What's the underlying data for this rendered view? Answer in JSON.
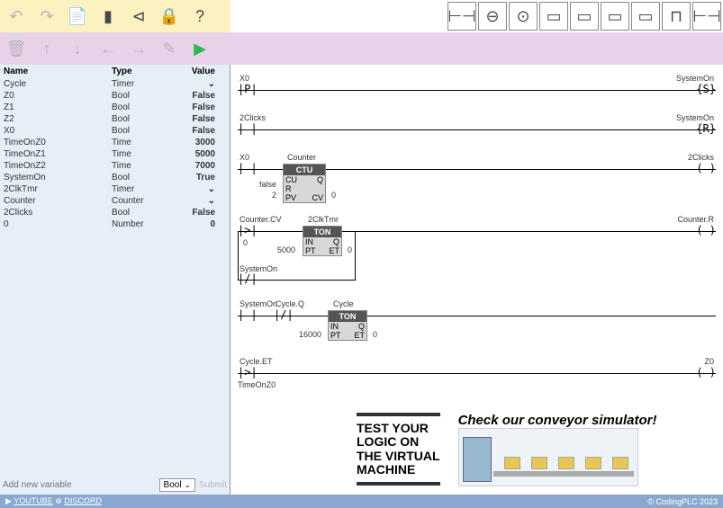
{
  "toolbar": {
    "yellow_icons": [
      "undo",
      "redo",
      "file",
      "page",
      "share",
      "lock",
      "help"
    ],
    "palette_icons": [
      "contact-no",
      "contact-nc",
      "timer",
      "block1",
      "block2",
      "block3",
      "block4",
      "coil",
      "branch"
    ],
    "purple_icons": [
      "delete",
      "up",
      "down",
      "left",
      "right",
      "edit",
      "run"
    ]
  },
  "variables": {
    "headers": {
      "name": "Name",
      "type": "Type",
      "value": "Value"
    },
    "rows": [
      {
        "name": "Cycle",
        "type": "Timer",
        "value": "⌄"
      },
      {
        "name": "Z0",
        "type": "Bool",
        "value": "False"
      },
      {
        "name": "Z1",
        "type": "Bool",
        "value": "False"
      },
      {
        "name": "Z2",
        "type": "Bool",
        "value": "False"
      },
      {
        "name": "X0",
        "type": "Bool",
        "value": "False"
      },
      {
        "name": "TimeOnZ0",
        "type": "Time",
        "value": "3000"
      },
      {
        "name": "TimeOnZ1",
        "type": "Time",
        "value": "5000"
      },
      {
        "name": "TimeOnZ2",
        "type": "Time",
        "value": "7000"
      },
      {
        "name": "SystemOn",
        "type": "Bool",
        "value": "True"
      },
      {
        "name": "2ClkTmr",
        "type": "Timer",
        "value": "⌄"
      },
      {
        "name": "Counter",
        "type": "Counter",
        "value": "⌄"
      },
      {
        "name": "2Clicks",
        "type": "Bool",
        "value": "False"
      },
      {
        "name": "0",
        "type": "Number",
        "value": "0"
      }
    ]
  },
  "add_variable": {
    "placeholder": "Add new variable",
    "type": "Bool",
    "submit": "Submit"
  },
  "ladder": {
    "r1": {
      "left_lbl": "X0",
      "left_sym": "|P|",
      "right_lbl": "SystemOn",
      "right_sym": "{S}"
    },
    "r2": {
      "left_lbl": "2Clicks",
      "left_sym": "| |",
      "right_lbl": "SystemOn",
      "right_sym": "{R}"
    },
    "r3": {
      "left_lbl": "X0",
      "left_sym": "| |",
      "blk_lbl": "Counter",
      "blk_hdr": "CTU",
      "p1": "CU",
      "p2": "Q",
      "p3": "R",
      "p4": "PV",
      "p5": "CV",
      "v1": "false",
      "v2": "2",
      "v3": "0",
      "right_lbl": "2Clicks",
      "right_sym": "( )"
    },
    "r4": {
      "left_lbl": "Counter.CV",
      "left_sym": "|>|",
      "left_sub": "0",
      "blk_lbl": "2ClkTmr",
      "blk_hdr": "TON",
      "p1": "IN",
      "p2": "Q",
      "p3": "PT",
      "p4": "ET",
      "v1": "5000",
      "v2": "0",
      "right_lbl": "Counter.R",
      "right_sym": "( )",
      "branch_lbl": "SystemOn",
      "branch_sym": "|/|"
    },
    "r5": {
      "l1_lbl": "SystemOn",
      "l1_sym": "| |",
      "l2_lbl": "Cycle.Q",
      "l2_sym": "|/|",
      "blk_lbl": "Cycle",
      "blk_hdr": "TON",
      "p1": "IN",
      "p2": "Q",
      "p3": "PT",
      "p4": "ET",
      "v1": "16000",
      "v2": "0"
    },
    "r6": {
      "left_lbl": "Cycle.ET",
      "left_sym": "|>|",
      "left_sub": "TimeOnZ0",
      "right_lbl": "Z0",
      "right_sym": "( )"
    }
  },
  "promo": {
    "text1": "TEST YOUR",
    "text2": "LOGIC ON",
    "text3": "THE VIRTUAL",
    "text4": "MACHINE",
    "tagline": "Check our conveyor simulator!"
  },
  "footer": {
    "youtube": "YOUTUBE",
    "discord": "DISCORD",
    "copy": "© CodingPLC 2023"
  }
}
